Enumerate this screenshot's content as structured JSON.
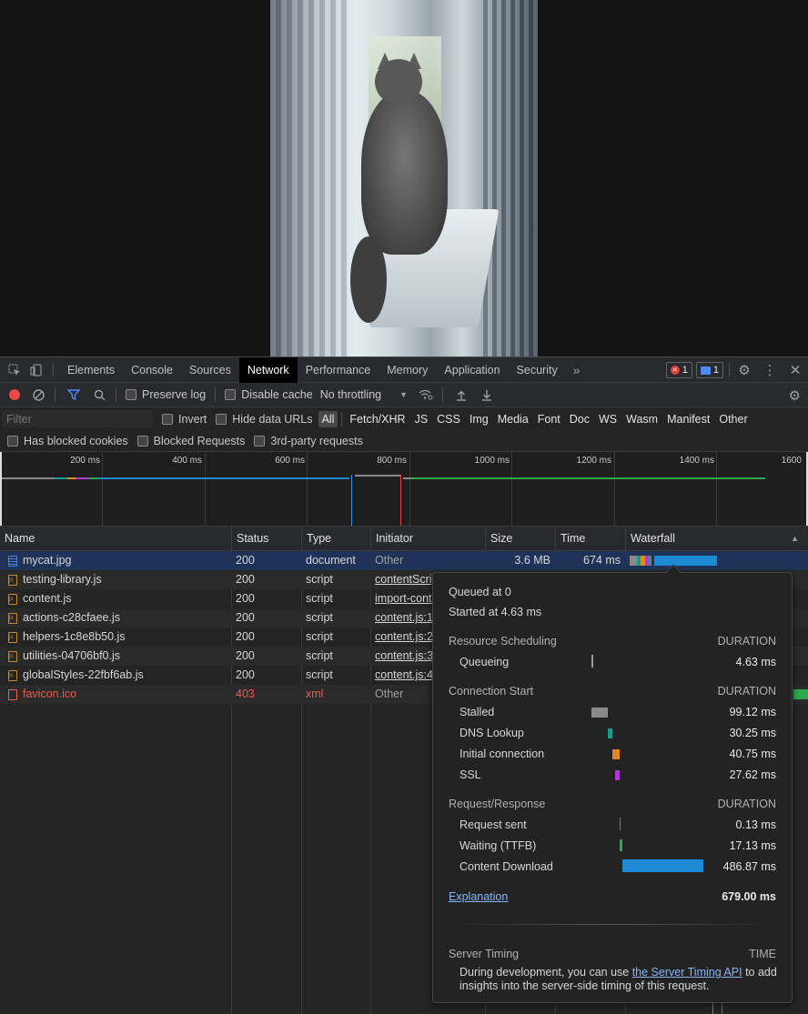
{
  "tabs": [
    "Elements",
    "Console",
    "Sources",
    "Network",
    "Performance",
    "Memory",
    "Application",
    "Security"
  ],
  "active_tab": "Network",
  "badges": {
    "errors": "1",
    "messages": "1"
  },
  "toolbar": {
    "preserve_log": "Preserve log",
    "disable_cache": "Disable cache",
    "throttling": "No throttling"
  },
  "filter": {
    "placeholder": "Filter",
    "invert": "Invert",
    "hide_data_urls": "Hide data URLs",
    "types": [
      "All",
      "Fetch/XHR",
      "JS",
      "CSS",
      "Img",
      "Media",
      "Font",
      "Doc",
      "WS",
      "Wasm",
      "Manifest",
      "Other"
    ],
    "active_type": "All"
  },
  "blocked": {
    "has_blocked_cookies": "Has blocked cookies",
    "blocked_requests": "Blocked Requests",
    "third_party": "3rd-party requests"
  },
  "overview": {
    "ticks": [
      "200 ms",
      "400 ms",
      "600 ms",
      "800 ms",
      "1000 ms",
      "1200 ms",
      "1400 ms",
      "1600"
    ]
  },
  "columns": [
    "Name",
    "Status",
    "Type",
    "Initiator",
    "Size",
    "Time",
    "Waterfall"
  ],
  "requests": [
    {
      "name": "mycat.jpg",
      "status": "200",
      "type": "document",
      "initiator": "Other",
      "size": "3.6 MB",
      "time": "674 ms",
      "icon": "doc",
      "link": false,
      "error": false
    },
    {
      "name": "testing-library.js",
      "status": "200",
      "type": "script",
      "initiator": "contentScript",
      "size": "",
      "time": "",
      "icon": "script",
      "link": true,
      "error": false
    },
    {
      "name": "content.js",
      "status": "200",
      "type": "script",
      "initiator": "import-content",
      "size": "",
      "time": "",
      "icon": "script",
      "link": true,
      "error": false
    },
    {
      "name": "actions-c28cfaee.js",
      "status": "200",
      "type": "script",
      "initiator": "content.js:1",
      "size": "",
      "time": "",
      "icon": "script",
      "link": true,
      "error": false
    },
    {
      "name": "helpers-1c8e8b50.js",
      "status": "200",
      "type": "script",
      "initiator": "content.js:2",
      "size": "",
      "time": "",
      "icon": "script",
      "link": true,
      "error": false
    },
    {
      "name": "utilities-04706bf0.js",
      "status": "200",
      "type": "script",
      "initiator": "content.js:3",
      "size": "",
      "time": "",
      "icon": "script",
      "link": true,
      "error": false
    },
    {
      "name": "globalStyles-22fbf6ab.js",
      "status": "200",
      "type": "script",
      "initiator": "content.js:4",
      "size": "",
      "time": "",
      "icon": "script",
      "link": true,
      "error": false
    },
    {
      "name": "favicon.ico",
      "status": "403",
      "type": "xml",
      "initiator": "Other",
      "size": "",
      "time": "",
      "icon": "err",
      "link": false,
      "error": true
    }
  ],
  "tooltip": {
    "queued": "Queued at 0",
    "started": "Started at 4.63 ms",
    "duration_label": "DURATION",
    "resource_scheduling": "Resource Scheduling",
    "queueing": {
      "label": "Queueing",
      "value": "4.63 ms"
    },
    "connection_start": "Connection Start",
    "stalled": {
      "label": "Stalled",
      "value": "99.12 ms"
    },
    "dns": {
      "label": "DNS Lookup",
      "value": "30.25 ms"
    },
    "initial": {
      "label": "Initial connection",
      "value": "40.75 ms"
    },
    "ssl": {
      "label": "SSL",
      "value": "27.62 ms"
    },
    "request_response": "Request/Response",
    "sent": {
      "label": "Request sent",
      "value": "0.13 ms"
    },
    "waiting": {
      "label": "Waiting (TTFB)",
      "value": "17.13 ms"
    },
    "download": {
      "label": "Content Download",
      "value": "486.87 ms"
    },
    "explanation": "Explanation",
    "total": "679.00 ms",
    "server_timing": "Server Timing",
    "time_label": "TIME",
    "note_before": "During development, you can use ",
    "note_link": "the Server Timing API",
    "note_after": " to add insights into the server-side timing of this request."
  },
  "colors": {
    "queueing": "#9a9a9a",
    "stalled": "#8a8a8a",
    "dns": "#1a9c8c",
    "initial": "#e08a26",
    "ssl": "#b338d6",
    "sent": "#2fa84f",
    "waiting": "#2fa84f",
    "download": "#1e8ad4",
    "selected_row": "#1f3358",
    "error_text": "#ef5a50",
    "link": "#8ab4f8"
  }
}
